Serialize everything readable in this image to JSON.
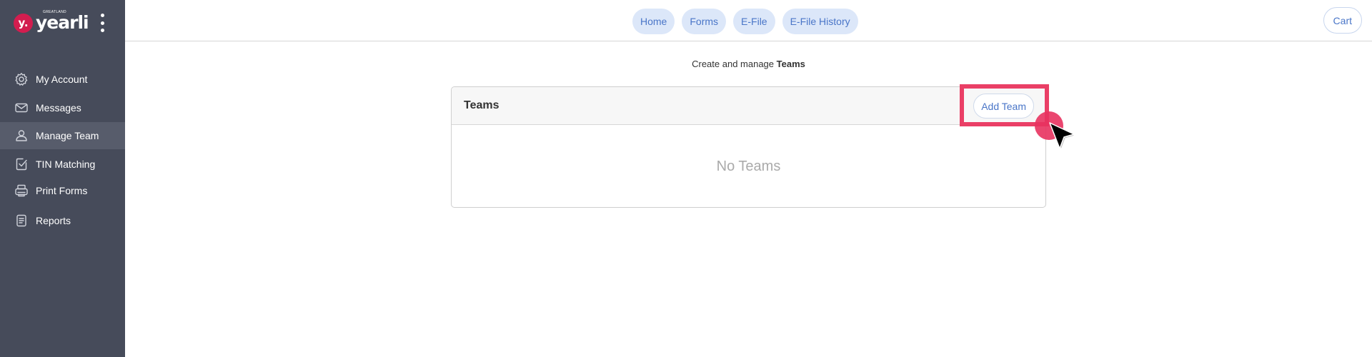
{
  "brand": {
    "mark": "y.",
    "name": "yearli",
    "super": "GREATLAND"
  },
  "sidebar": {
    "items": [
      {
        "label": "My Account",
        "icon": "gear-icon",
        "active": false
      },
      {
        "label": "Messages",
        "icon": "envelope-icon",
        "active": false
      },
      {
        "label": "Manage Team",
        "icon": "user-icon",
        "active": true
      },
      {
        "label": "TIN Matching",
        "icon": "check-square-icon",
        "active": false
      },
      {
        "label": "Print Forms",
        "icon": "printer-icon",
        "active": false
      },
      {
        "label": "Reports",
        "icon": "document-icon",
        "active": false
      }
    ]
  },
  "topnav": {
    "items": [
      "Home",
      "Forms",
      "E-File",
      "E-File History"
    ],
    "cart": "Cart"
  },
  "main": {
    "subtitle_prefix": "Create and manage ",
    "subtitle_bold": "Teams",
    "panel_title": "Teams",
    "add_button": "Add Team",
    "empty_text": "No Teams"
  },
  "colors": {
    "sidebar_bg": "#464b5a",
    "sidebar_active": "#575c6b",
    "brand_red": "#d31d4f",
    "pill_bg": "#dce7f9",
    "link_blue": "#4a76c8",
    "highlight": "#ea3f66"
  }
}
